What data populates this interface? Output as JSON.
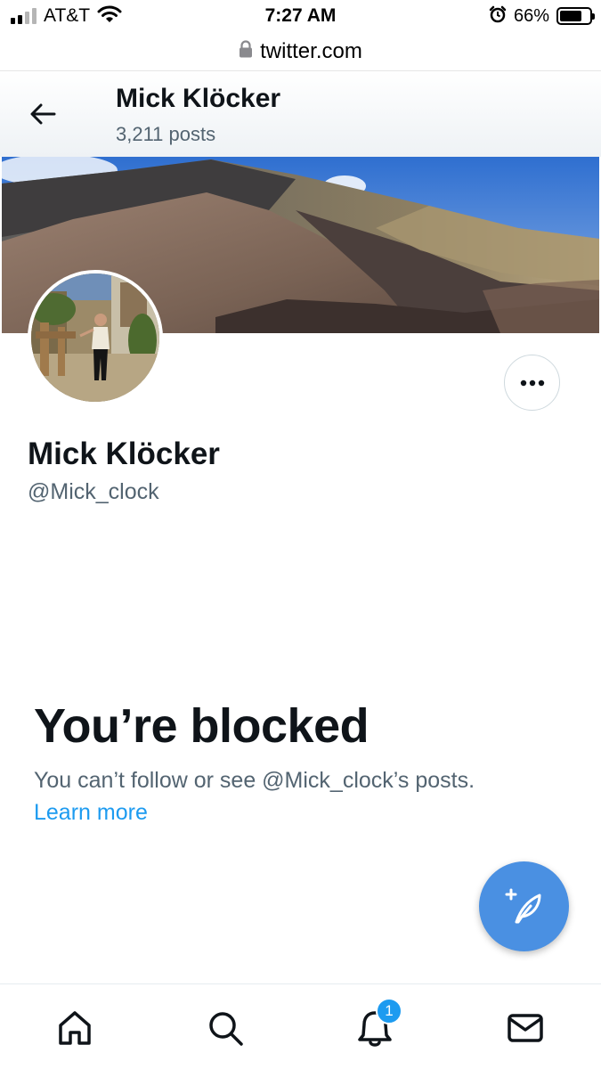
{
  "status_bar": {
    "carrier": "AT&T",
    "time": "7:27 AM",
    "battery_percent": "66%",
    "battery_level": 0.66,
    "signal_bars": 2,
    "icons": [
      "signal-icon",
      "wifi-icon",
      "alarm-icon",
      "battery-icon"
    ]
  },
  "browser": {
    "url": "twitter.com",
    "icons": [
      "lock-icon"
    ]
  },
  "profile_header": {
    "name": "Mick Klöcker",
    "post_count": "3,211 posts"
  },
  "profile": {
    "display_name": "Mick Klöcker",
    "handle": "@Mick_clock"
  },
  "blocked": {
    "title": "You’re blocked",
    "description": "You can’t follow or see @Mick_clock’s posts.",
    "link_label": "Learn more"
  },
  "bottom_nav": {
    "items": [
      "home-icon",
      "search-icon",
      "notifications-icon",
      "messages-icon"
    ],
    "notification_count": "1"
  },
  "colors": {
    "accent": "#1d9bf0",
    "fab": "#4a90e2",
    "text_primary": "#0f1419",
    "text_secondary": "#536471"
  }
}
